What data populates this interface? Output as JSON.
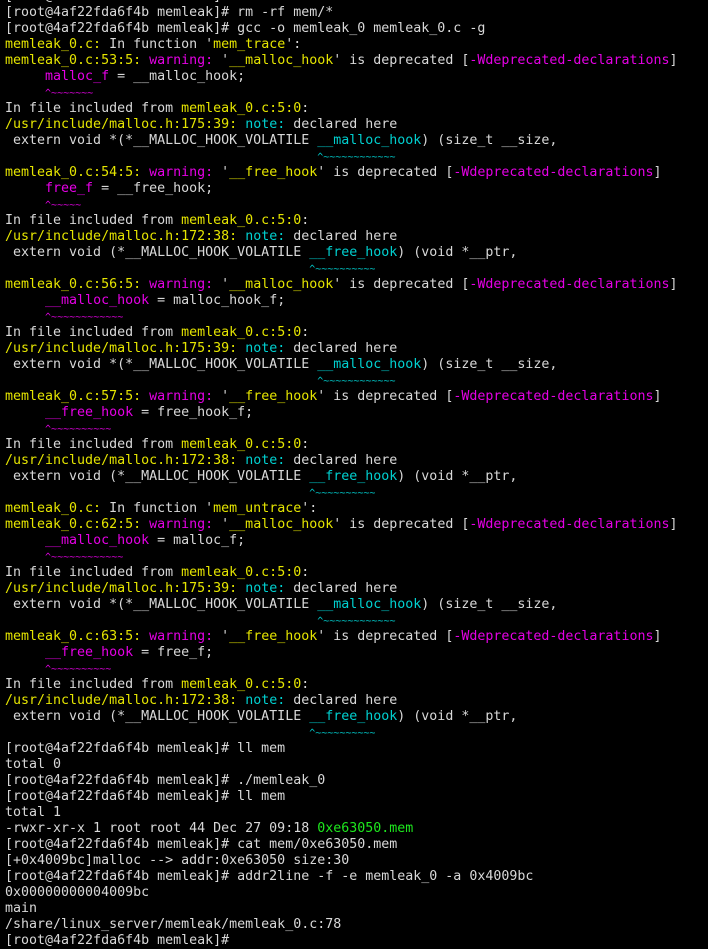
{
  "terminal": {
    "prompt": "[root@4af22fda6f4b memleak]# ",
    "lines": [
      [
        {
          "t": "[root@4af22fda6f4b memleak]#",
          "c": "default"
        }
      ],
      [
        {
          "t": "[root@4af22fda6f4b memleak]# rm -rf mem/*",
          "c": "default"
        }
      ],
      [
        {
          "t": "[root@4af22fda6f4b memleak]# gcc -o memleak_0 memleak_0.c -g",
          "c": "default"
        }
      ],
      [
        {
          "t": "memleak_0.c:",
          "c": "yellow"
        },
        {
          "t": " In function '",
          "c": "default"
        },
        {
          "t": "mem_trace",
          "c": "yellow"
        },
        {
          "t": "':",
          "c": "default"
        }
      ],
      [
        {
          "t": "memleak_0.c:53:5:",
          "c": "yellow"
        },
        {
          "t": " ",
          "c": "default"
        },
        {
          "t": "warning:",
          "c": "magenta"
        },
        {
          "t": " '",
          "c": "default"
        },
        {
          "t": "__malloc_hook",
          "c": "yellow"
        },
        {
          "t": "' is deprecated [",
          "c": "default"
        },
        {
          "t": "-Wdeprecated-declarations",
          "c": "magenta"
        },
        {
          "t": "]",
          "c": "default"
        }
      ],
      [
        {
          "t": "     ",
          "c": "default"
        },
        {
          "t": "malloc_f",
          "c": "magenta"
        },
        {
          "t": " = __malloc_hook;",
          "c": "default"
        }
      ],
      [
        {
          "t": "     ",
          "c": "default"
        },
        {
          "t": "^~~~~~~~",
          "c": "magenta"
        }
      ],
      [
        {
          "t": "In file included from ",
          "c": "default"
        },
        {
          "t": "memleak_0.c:5:0",
          "c": "yellow"
        },
        {
          "t": ":",
          "c": "default"
        }
      ],
      [
        {
          "t": "/usr/include/malloc.h:175:39:",
          "c": "yellow"
        },
        {
          "t": " ",
          "c": "default"
        },
        {
          "t": "note:",
          "c": "cyan"
        },
        {
          "t": " declared here",
          "c": "default"
        }
      ],
      [
        {
          "t": " extern void *(*__MALLOC_HOOK_VOLATILE ",
          "c": "default"
        },
        {
          "t": "__malloc_hook",
          "c": "cyan"
        },
        {
          "t": ") (size_t __size,",
          "c": "default"
        }
      ],
      [
        {
          "t": "                                       ",
          "c": "default"
        },
        {
          "t": "^~~~~~~~~~~~~",
          "c": "cyan"
        }
      ],
      [
        {
          "t": "memleak_0.c:54:5:",
          "c": "yellow"
        },
        {
          "t": " ",
          "c": "default"
        },
        {
          "t": "warning:",
          "c": "magenta"
        },
        {
          "t": " '",
          "c": "default"
        },
        {
          "t": "__free_hook",
          "c": "yellow"
        },
        {
          "t": "' is deprecated [",
          "c": "default"
        },
        {
          "t": "-Wdeprecated-declarations",
          "c": "magenta"
        },
        {
          "t": "]",
          "c": "default"
        }
      ],
      [
        {
          "t": "     ",
          "c": "default"
        },
        {
          "t": "free_f",
          "c": "magenta"
        },
        {
          "t": " = __free_hook;",
          "c": "default"
        }
      ],
      [
        {
          "t": "     ",
          "c": "default"
        },
        {
          "t": "^~~~~~",
          "c": "magenta"
        }
      ],
      [
        {
          "t": "In file included from ",
          "c": "default"
        },
        {
          "t": "memleak_0.c:5:0",
          "c": "yellow"
        },
        {
          "t": ":",
          "c": "default"
        }
      ],
      [
        {
          "t": "/usr/include/malloc.h:172:38:",
          "c": "yellow"
        },
        {
          "t": " ",
          "c": "default"
        },
        {
          "t": "note:",
          "c": "cyan"
        },
        {
          "t": " declared here",
          "c": "default"
        }
      ],
      [
        {
          "t": " extern void (*__MALLOC_HOOK_VOLATILE ",
          "c": "default"
        },
        {
          "t": "__free_hook",
          "c": "cyan"
        },
        {
          "t": ") (void *__ptr,",
          "c": "default"
        }
      ],
      [
        {
          "t": "                                      ",
          "c": "default"
        },
        {
          "t": "^~~~~~~~~~~",
          "c": "cyan"
        }
      ],
      [
        {
          "t": "memleak_0.c:56:5:",
          "c": "yellow"
        },
        {
          "t": " ",
          "c": "default"
        },
        {
          "t": "warning:",
          "c": "magenta"
        },
        {
          "t": " '",
          "c": "default"
        },
        {
          "t": "__malloc_hook",
          "c": "yellow"
        },
        {
          "t": "' is deprecated [",
          "c": "default"
        },
        {
          "t": "-Wdeprecated-declarations",
          "c": "magenta"
        },
        {
          "t": "]",
          "c": "default"
        }
      ],
      [
        {
          "t": "     ",
          "c": "default"
        },
        {
          "t": "__malloc_hook",
          "c": "magenta"
        },
        {
          "t": " = malloc_hook_f;",
          "c": "default"
        }
      ],
      [
        {
          "t": "     ",
          "c": "default"
        },
        {
          "t": "^~~~~~~~~~~~~",
          "c": "magenta"
        }
      ],
      [
        {
          "t": "In file included from ",
          "c": "default"
        },
        {
          "t": "memleak_0.c:5:0",
          "c": "yellow"
        },
        {
          "t": ":",
          "c": "default"
        }
      ],
      [
        {
          "t": "/usr/include/malloc.h:175:39:",
          "c": "yellow"
        },
        {
          "t": " ",
          "c": "default"
        },
        {
          "t": "note:",
          "c": "cyan"
        },
        {
          "t": " declared here",
          "c": "default"
        }
      ],
      [
        {
          "t": " extern void *(*__MALLOC_HOOK_VOLATILE ",
          "c": "default"
        },
        {
          "t": "__malloc_hook",
          "c": "cyan"
        },
        {
          "t": ") (size_t __size,",
          "c": "default"
        }
      ],
      [
        {
          "t": "                                       ",
          "c": "default"
        },
        {
          "t": "^~~~~~~~~~~~~",
          "c": "cyan"
        }
      ],
      [
        {
          "t": "memleak_0.c:57:5:",
          "c": "yellow"
        },
        {
          "t": " ",
          "c": "default"
        },
        {
          "t": "warning:",
          "c": "magenta"
        },
        {
          "t": " '",
          "c": "default"
        },
        {
          "t": "__free_hook",
          "c": "yellow"
        },
        {
          "t": "' is deprecated [",
          "c": "default"
        },
        {
          "t": "-Wdeprecated-declarations",
          "c": "magenta"
        },
        {
          "t": "]",
          "c": "default"
        }
      ],
      [
        {
          "t": "     ",
          "c": "default"
        },
        {
          "t": "__free_hook",
          "c": "magenta"
        },
        {
          "t": " = free_hook_f;",
          "c": "default"
        }
      ],
      [
        {
          "t": "     ",
          "c": "default"
        },
        {
          "t": "^~~~~~~~~~~",
          "c": "magenta"
        }
      ],
      [
        {
          "t": "In file included from ",
          "c": "default"
        },
        {
          "t": "memleak_0.c:5:0",
          "c": "yellow"
        },
        {
          "t": ":",
          "c": "default"
        }
      ],
      [
        {
          "t": "/usr/include/malloc.h:172:38:",
          "c": "yellow"
        },
        {
          "t": " ",
          "c": "default"
        },
        {
          "t": "note:",
          "c": "cyan"
        },
        {
          "t": " declared here",
          "c": "default"
        }
      ],
      [
        {
          "t": " extern void (*__MALLOC_HOOK_VOLATILE ",
          "c": "default"
        },
        {
          "t": "__free_hook",
          "c": "cyan"
        },
        {
          "t": ") (void *__ptr,",
          "c": "default"
        }
      ],
      [
        {
          "t": "                                      ",
          "c": "default"
        },
        {
          "t": "^~~~~~~~~~~",
          "c": "cyan"
        }
      ],
      [
        {
          "t": "memleak_0.c:",
          "c": "yellow"
        },
        {
          "t": " In function '",
          "c": "default"
        },
        {
          "t": "mem_untrace",
          "c": "yellow"
        },
        {
          "t": "':",
          "c": "default"
        }
      ],
      [
        {
          "t": "memleak_0.c:62:5:",
          "c": "yellow"
        },
        {
          "t": " ",
          "c": "default"
        },
        {
          "t": "warning:",
          "c": "magenta"
        },
        {
          "t": " '",
          "c": "default"
        },
        {
          "t": "__malloc_hook",
          "c": "yellow"
        },
        {
          "t": "' is deprecated [",
          "c": "default"
        },
        {
          "t": "-Wdeprecated-declarations",
          "c": "magenta"
        },
        {
          "t": "]",
          "c": "default"
        }
      ],
      [
        {
          "t": "     ",
          "c": "default"
        },
        {
          "t": "__malloc_hook",
          "c": "magenta"
        },
        {
          "t": " = malloc_f;",
          "c": "default"
        }
      ],
      [
        {
          "t": "     ",
          "c": "default"
        },
        {
          "t": "^~~~~~~~~~~~~",
          "c": "magenta"
        }
      ],
      [
        {
          "t": "In file included from ",
          "c": "default"
        },
        {
          "t": "memleak_0.c:5:0",
          "c": "yellow"
        },
        {
          "t": ":",
          "c": "default"
        }
      ],
      [
        {
          "t": "/usr/include/malloc.h:175:39:",
          "c": "yellow"
        },
        {
          "t": " ",
          "c": "default"
        },
        {
          "t": "note:",
          "c": "cyan"
        },
        {
          "t": " declared here",
          "c": "default"
        }
      ],
      [
        {
          "t": " extern void *(*__MALLOC_HOOK_VOLATILE ",
          "c": "default"
        },
        {
          "t": "__malloc_hook",
          "c": "cyan"
        },
        {
          "t": ") (size_t __size,",
          "c": "default"
        }
      ],
      [
        {
          "t": "                                       ",
          "c": "default"
        },
        {
          "t": "^~~~~~~~~~~~~",
          "c": "cyan"
        }
      ],
      [
        {
          "t": "memleak_0.c:63:5:",
          "c": "yellow"
        },
        {
          "t": " ",
          "c": "default"
        },
        {
          "t": "warning:",
          "c": "magenta"
        },
        {
          "t": " '",
          "c": "default"
        },
        {
          "t": "__free_hook",
          "c": "yellow"
        },
        {
          "t": "' is deprecated [",
          "c": "default"
        },
        {
          "t": "-Wdeprecated-declarations",
          "c": "magenta"
        },
        {
          "t": "]",
          "c": "default"
        }
      ],
      [
        {
          "t": "     ",
          "c": "default"
        },
        {
          "t": "__free_hook",
          "c": "magenta"
        },
        {
          "t": " = free_f;",
          "c": "default"
        }
      ],
      [
        {
          "t": "     ",
          "c": "default"
        },
        {
          "t": "^~~~~~~~~~~",
          "c": "magenta"
        }
      ],
      [
        {
          "t": "In file included from ",
          "c": "default"
        },
        {
          "t": "memleak_0.c:5:0",
          "c": "yellow"
        },
        {
          "t": ":",
          "c": "default"
        }
      ],
      [
        {
          "t": "/usr/include/malloc.h:172:38:",
          "c": "yellow"
        },
        {
          "t": " ",
          "c": "default"
        },
        {
          "t": "note:",
          "c": "cyan"
        },
        {
          "t": " declared here",
          "c": "default"
        }
      ],
      [
        {
          "t": " extern void (*__MALLOC_HOOK_VOLATILE ",
          "c": "default"
        },
        {
          "t": "__free_hook",
          "c": "cyan"
        },
        {
          "t": ") (void *__ptr,",
          "c": "default"
        }
      ],
      [
        {
          "t": "                                      ",
          "c": "default"
        },
        {
          "t": "^~~~~~~~~~~",
          "c": "cyan"
        }
      ],
      [
        {
          "t": "[root@4af22fda6f4b memleak]# ll mem",
          "c": "default"
        }
      ],
      [
        {
          "t": "total 0",
          "c": "default"
        }
      ],
      [
        {
          "t": "[root@4af22fda6f4b memleak]# ./memleak_0",
          "c": "default"
        }
      ],
      [
        {
          "t": "[root@4af22fda6f4b memleak]# ll mem",
          "c": "default"
        }
      ],
      [
        {
          "t": "total 1",
          "c": "default"
        }
      ],
      [
        {
          "t": "-rwxr-xr-x 1 root root 44 Dec 27 09:18 ",
          "c": "default"
        },
        {
          "t": "0xe63050.mem",
          "c": "green"
        }
      ],
      [
        {
          "t": "[root@4af22fda6f4b memleak]# cat mem/0xe63050.mem",
          "c": "default"
        }
      ],
      [
        {
          "t": "[+0x4009bc]malloc --> addr:0xe63050 size:30",
          "c": "default"
        }
      ],
      [
        {
          "t": "[root@4af22fda6f4b memleak]# addr2line -f -e memleak_0 -a 0x4009bc",
          "c": "default"
        }
      ],
      [
        {
          "t": "0x00000000004009bc",
          "c": "default"
        }
      ],
      [
        {
          "t": "main",
          "c": "default"
        }
      ],
      [
        {
          "t": "/share/linux_server/memleak/memleak_0.c:78",
          "c": "default"
        }
      ],
      [
        {
          "t": "[root@4af22fda6f4b memleak]#",
          "c": "default"
        }
      ]
    ]
  },
  "colors": {
    "background": "#000000",
    "default": "#d8d8d8",
    "yellow": "#e5e500",
    "magenta": "#e500e5",
    "cyan": "#00d0d0",
    "green": "#1ee81e"
  }
}
